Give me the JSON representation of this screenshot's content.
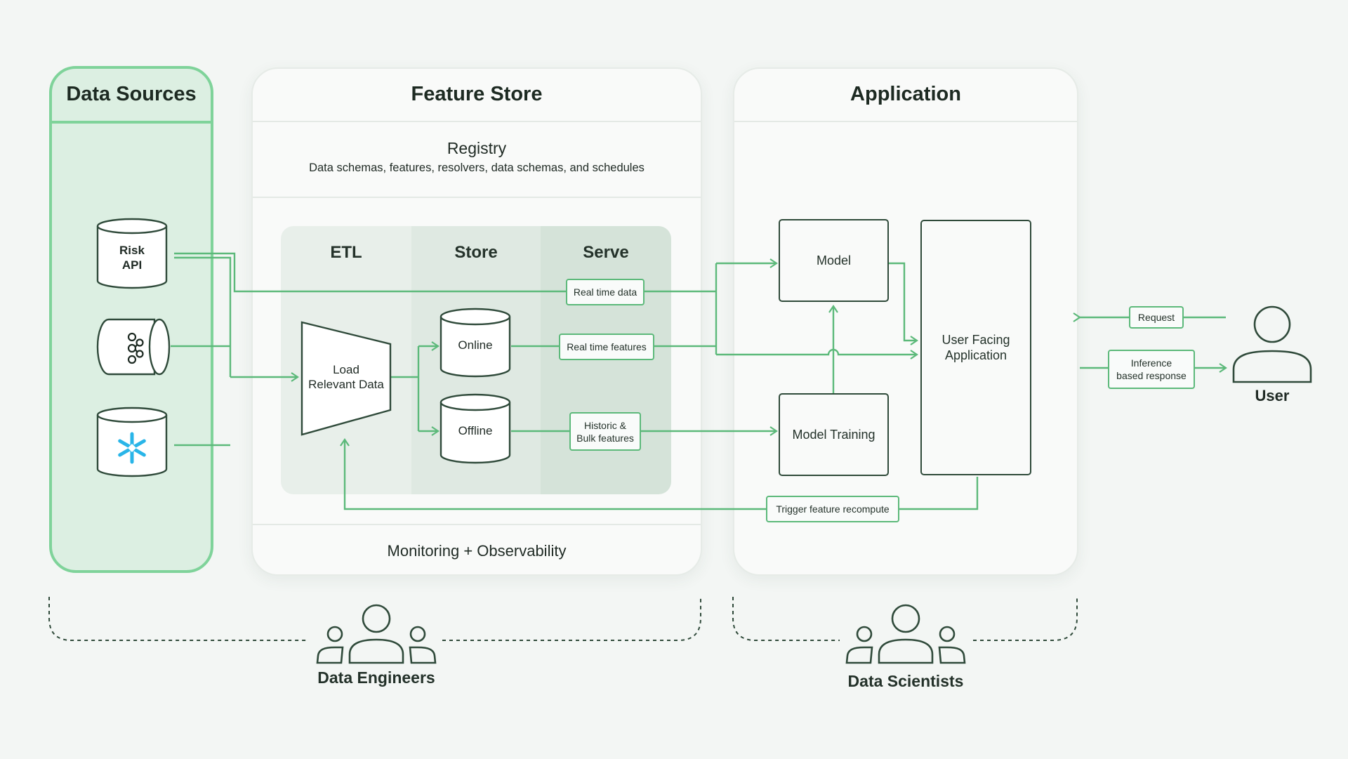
{
  "data_sources": {
    "title": "Data Sources",
    "risk_api": "Risk\nAPI",
    "kafka_icon": "kafka-icon",
    "snowflake_icon": "snowflake-icon"
  },
  "feature_store": {
    "title": "Feature Store",
    "registry_title": "Registry",
    "registry_subtitle": "Data schemas, features, resolvers, data schemas, and schedules",
    "columns": [
      "ETL",
      "Store",
      "Serve"
    ],
    "load_label": "Load\nRelevant Data",
    "online_label": "Online",
    "offline_label": "Offline",
    "monitoring_label": "Monitoring + Observability"
  },
  "tags": {
    "real_time_data": "Real time data",
    "real_time_features": "Real time features",
    "historic_bulk": "Historic &\nBulk features",
    "trigger_recompute": "Trigger feature recompute",
    "request": "Request",
    "inference_response": "Inference\nbased response"
  },
  "application": {
    "title": "Application",
    "model": "Model",
    "model_training": "Model Training",
    "user_facing_app": "User Facing\nApplication"
  },
  "user": {
    "label": "User"
  },
  "teams": {
    "data_engineers": "Data Engineers",
    "data_scientists": "Data Scientists"
  },
  "colors": {
    "green_line": "#5cb97a",
    "dark_line": "#2f4a3a",
    "data_sources_fill": "#dcefe2",
    "data_sources_border": "#7fd39a"
  }
}
